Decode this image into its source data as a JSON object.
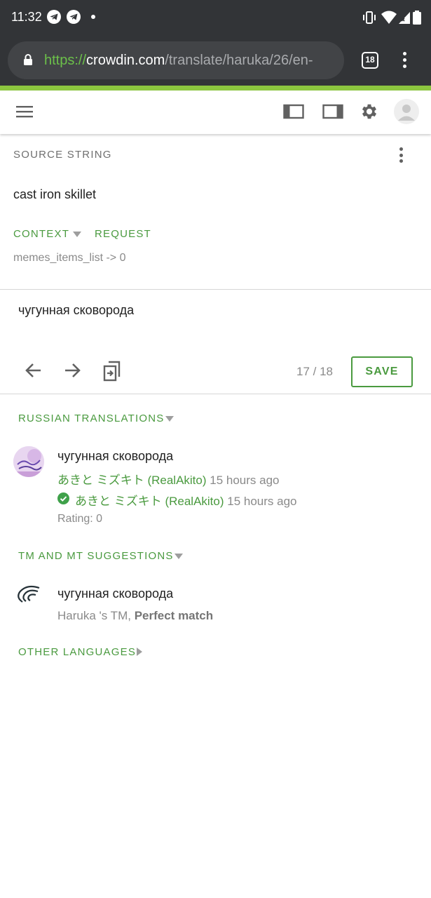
{
  "status_bar": {
    "time": "11:32",
    "notification_icons": [
      "telegram-icon",
      "telegram-icon",
      "dot-icon"
    ],
    "system_icons": [
      "vibrate-icon",
      "wifi-icon",
      "signal-icon",
      "battery-icon"
    ]
  },
  "browser": {
    "url_scheme": "https://",
    "url_host": "crowdin.com",
    "url_path": "/translate/haruka/26/en-",
    "tab_count": "18",
    "accent_strip_color": "#8cc63f"
  },
  "toolbar": {
    "icons": [
      "menu-icon",
      "left-panel-icon",
      "right-panel-icon",
      "settings-gear-icon",
      "user-avatar-icon"
    ]
  },
  "source": {
    "label": "SOURCE STRING",
    "text": "cast iron skillet",
    "context_label": "CONTEXT",
    "request_label": "REQUEST",
    "context_value": "memes_items_list -> 0"
  },
  "editor": {
    "translation": "чугунная сковорода",
    "counter": "17 / 18",
    "save_label": "SAVE"
  },
  "russian_translations": {
    "title": "RUSSIAN TRANSLATIONS",
    "items": [
      {
        "text": "чугунная сковорода",
        "author": "あきと ミズキト (RealAkito)",
        "author_time": "15 hours ago",
        "approver": "あきと ミズキト (RealAkito)",
        "approver_time": "15 hours ago",
        "rating": "Rating: 0"
      }
    ]
  },
  "tm_suggestions": {
    "title": "TM AND MT SUGGESTIONS",
    "items": [
      {
        "text": "чугунная сковорода",
        "source": "Haruka 's TM,",
        "match": "Perfect match"
      }
    ]
  },
  "other_languages": {
    "title": "OTHER LANGUAGES"
  },
  "colors": {
    "accent_green": "#4a9a3f",
    "approved_check": "#3fa14a",
    "status_bar_bg": "#323437"
  }
}
